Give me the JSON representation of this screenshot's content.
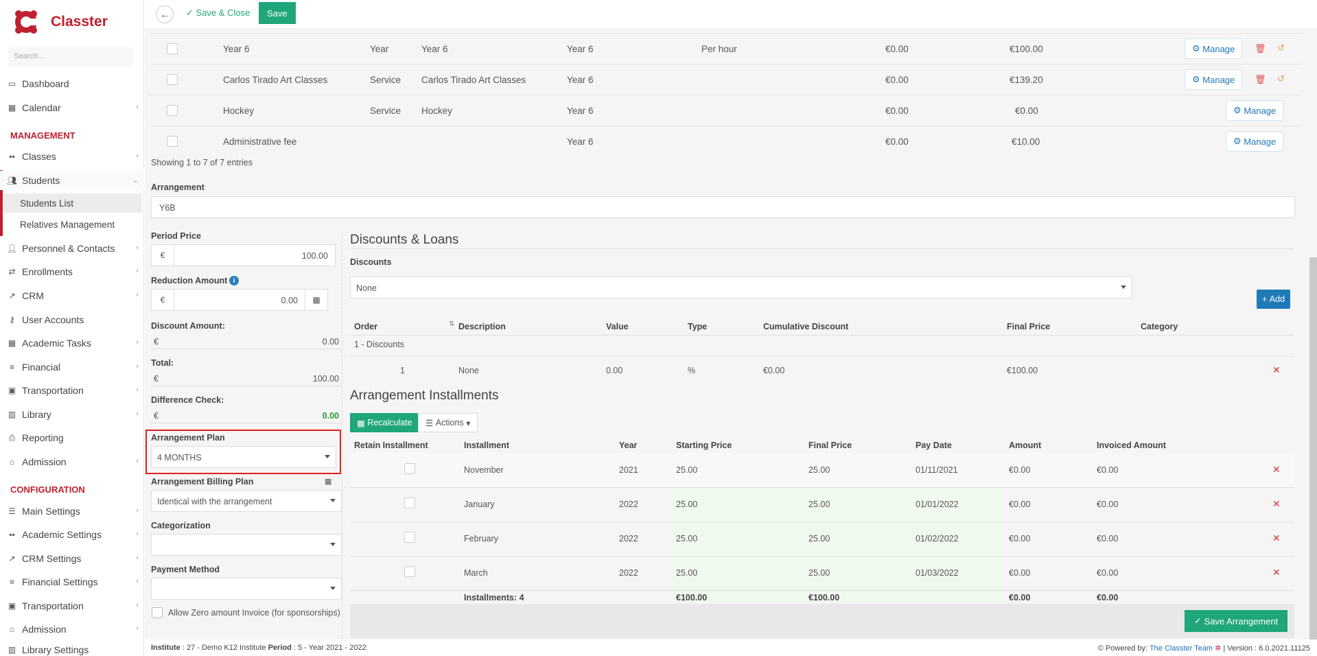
{
  "app": {
    "brand": "Classter"
  },
  "sidebar": {
    "search_placeholder": "Search...",
    "items": [
      {
        "label": "Dashboard",
        "icon": "dashboard-icon"
      },
      {
        "label": "Calendar",
        "icon": "calendar-icon"
      },
      {
        "label": "Classes",
        "icon": "classes-icon"
      },
      {
        "label": "Students",
        "icon": "students-icon"
      },
      {
        "label": "Personnel & Contacts",
        "icon": "personnel-icon"
      },
      {
        "label": "Enrollments",
        "icon": "enrollments-icon"
      },
      {
        "label": "CRM",
        "icon": "crm-icon"
      },
      {
        "label": "User Accounts",
        "icon": "key-icon"
      },
      {
        "label": "Academic Tasks",
        "icon": "tasks-icon"
      },
      {
        "label": "Financial",
        "icon": "coins-icon"
      },
      {
        "label": "Transportation",
        "icon": "bus-icon"
      },
      {
        "label": "Library",
        "icon": "books-icon"
      },
      {
        "label": "Reporting",
        "icon": "printer-icon"
      },
      {
        "label": "Admission",
        "icon": "building-icon"
      },
      {
        "label": "Main Settings",
        "icon": "settings-icon"
      },
      {
        "label": "Academic Settings",
        "icon": "academic-settings-icon"
      },
      {
        "label": "CRM Settings",
        "icon": "crm-settings-icon"
      },
      {
        "label": "Financial Settings",
        "icon": "coins-icon"
      },
      {
        "label": "Transportation",
        "icon": "bus-icon"
      },
      {
        "label": "Admission",
        "icon": "building-icon"
      },
      {
        "label": "Library Settings",
        "icon": "books-icon"
      }
    ],
    "sections": {
      "management": "MANAGEMENT",
      "configuration": "CONFIGURATION"
    },
    "students_sub": [
      "Students List",
      "Relatives Management"
    ]
  },
  "toolbar": {
    "save_close": "Save & Close",
    "save": "Save"
  },
  "services_table": {
    "rows": [
      {
        "name": "Year 6",
        "type": "Year",
        "desc": "Year 6",
        "grade": "Year 6",
        "unit": "Per hour",
        "price1": "€0.00",
        "price2": "€100.00",
        "deletable": true
      },
      {
        "name": "Carlos Tirado Art Classes",
        "type": "Service",
        "desc": "Carlos Tirado Art Classes",
        "grade": "Year 6",
        "unit": "",
        "price1": "€0.00",
        "price2": "€139.20",
        "deletable": true
      },
      {
        "name": "Hockey",
        "type": "Service",
        "desc": "Hockey",
        "grade": "Year 6",
        "unit": "",
        "price1": "€0.00",
        "price2": "€0.00",
        "deletable": false
      },
      {
        "name": "Administrative fee",
        "type": "",
        "desc": "",
        "grade": "Year 6",
        "unit": "",
        "price1": "€0.00",
        "price2": "€10.00",
        "deletable": false
      }
    ],
    "manage_label": "Manage",
    "showing": "Showing 1 to 7 of 7 entries"
  },
  "arrangement": {
    "label": "Arrangement",
    "value": "Y6B",
    "period_price_label": "Period Price",
    "period_price": "100.00",
    "currency": "€",
    "reduction_label": "Reduction Amount",
    "reduction": "0.00",
    "discount_label": "Discount Amount:",
    "discount": "0.00",
    "total_label": "Total:",
    "total": "100.00",
    "diff_label": "Difference Check:",
    "diff": "0.00",
    "plan_label": "Arrangement Plan",
    "plan": "4 MONTHS",
    "billing_label": "Arrangement Billing Plan",
    "billing": "Identical with the arrangement",
    "categorization_label": "Categorization",
    "payment_label": "Payment Method",
    "allow_zero": "Allow Zero amount Invoice (for sponsorships)"
  },
  "discounts": {
    "title": "Discounts & Loans",
    "label": "Discounts",
    "selected": "None",
    "add": "Add",
    "headers": [
      "Order",
      "Description",
      "Value",
      "Type",
      "Cumulative Discount",
      "Final Price",
      "Category"
    ],
    "group": "1 - Discounts",
    "row": {
      "order": "1",
      "desc": "None",
      "value": "0.00",
      "type": "%",
      "cumulative": "€0.00",
      "final": "€100.00",
      "category": ""
    }
  },
  "installments": {
    "title": "Arrangement Installments",
    "recalculate": "Recalculate",
    "actions": "Actions",
    "headers": [
      "Retain Installment",
      "Installment",
      "Year",
      "Starting Price",
      "Final Price",
      "Pay Date",
      "Amount",
      "Invoiced Amount"
    ],
    "rows": [
      {
        "name": "November",
        "year": "2021",
        "start": "25.00",
        "final": "25.00",
        "date": "01/11/2021",
        "amount": "€0.00",
        "invoiced": "€0.00"
      },
      {
        "name": "January",
        "year": "2022",
        "start": "25.00",
        "final": "25.00",
        "date": "01/01/2022",
        "amount": "€0.00",
        "invoiced": "€0.00"
      },
      {
        "name": "February",
        "year": "2022",
        "start": "25.00",
        "final": "25.00",
        "date": "01/02/2022",
        "amount": "€0.00",
        "invoiced": "€0.00"
      },
      {
        "name": "March",
        "year": "2022",
        "start": "25.00",
        "final": "25.00",
        "date": "01/03/2022",
        "amount": "€0.00",
        "invoiced": "€0.00"
      }
    ],
    "summary": {
      "count": "Installments: 4",
      "start": "€100.00",
      "final": "€100.00",
      "amount": "€0.00",
      "invoiced": "€0.00"
    },
    "save": "Save Arrangement"
  },
  "footer": {
    "institute_label": "Institute",
    "institute": ": 27 - Demo K12 Institute",
    "period_label": "Period",
    "period": ": 5 - Year 2021 - 2022",
    "powered": "Powered by:",
    "team": "The Classter Team",
    "version": "| Version : 6.0.2021.11125"
  },
  "colors": {
    "brand": "#c0202f",
    "green": "#1fa67a",
    "blue": "#1f7ab8",
    "red": "#e02020"
  }
}
